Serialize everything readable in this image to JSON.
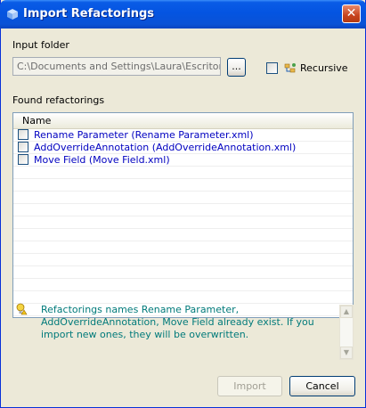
{
  "window": {
    "title": "Import Refactorings",
    "close_glyph": "✕"
  },
  "input_folder": {
    "label": "Input folder",
    "value": "C:\\Documents and Settings\\Laura\\Escritorio",
    "browse_label": "...",
    "recursive_label": "Recursive",
    "recursive_checked": false
  },
  "found": {
    "label": "Found refactorings",
    "column_header": "Name",
    "rows": [
      {
        "label": "Rename Parameter (Rename Parameter.xml)",
        "checked": false
      },
      {
        "label": "AddOverrideAnnotation (AddOverrideAnnotation.xml)",
        "checked": false
      },
      {
        "label": "Move Field (Move Field.xml)",
        "checked": false
      }
    ]
  },
  "message": {
    "icon": "warning-lightbulb-icon",
    "text": "Refactorings names Rename Parameter, AddOverrideAnnotation, Move Field already exist. If you import new ones, they will be overwritten."
  },
  "buttons": {
    "import_label": "Import",
    "import_enabled": false,
    "cancel_label": "Cancel"
  },
  "colors": {
    "titlebar": "#0454e1",
    "dialog_bg": "#ece9d8",
    "row_text": "#0000c0",
    "message_text": "#007a7a"
  }
}
